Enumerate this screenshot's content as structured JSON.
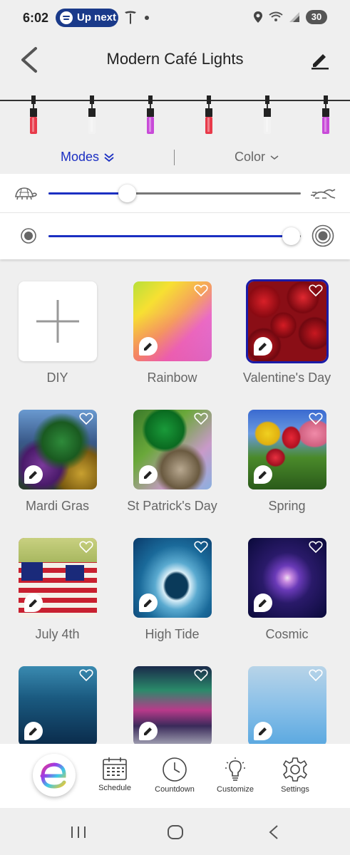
{
  "status_bar": {
    "time": "6:02",
    "media_pill": "Up next",
    "battery": "30",
    "icons": [
      "spotify-icon",
      "tesla-icon",
      "location-icon",
      "wifi-icon",
      "signal-icon"
    ]
  },
  "header": {
    "title": "Modern Café Lights",
    "back_icon": "back-chevron-icon",
    "edit_icon": "pencil-icon"
  },
  "light_string": {
    "bulb_colors": [
      "#e83a4a",
      "#f2f2f2",
      "#c84ad8",
      "#e83a4a",
      "#f2f2f2",
      "#c84ad8"
    ]
  },
  "tabs": {
    "modes_label": "Modes",
    "color_label": "Color",
    "active": "Modes"
  },
  "sliders": {
    "speed": {
      "value_percent": 31,
      "left_icon": "turtle-icon",
      "right_icon": "rabbit-icon"
    },
    "brightness": {
      "value_percent": 96,
      "left_icon": "dim-circle-icon",
      "right_icon": "bright-circle-icon"
    }
  },
  "modes": [
    {
      "label": "DIY",
      "type": "diy"
    },
    {
      "label": "Rainbow",
      "favorite": false
    },
    {
      "label": "Valentine's Day",
      "favorite": false,
      "selected": true
    },
    {
      "label": "Mardi Gras",
      "favorite": false
    },
    {
      "label": "St Patrick's Day",
      "favorite": false
    },
    {
      "label": "Spring",
      "favorite": false
    },
    {
      "label": "July 4th",
      "favorite": false
    },
    {
      "label": "High Tide",
      "favorite": false
    },
    {
      "label": "Cosmic",
      "favorite": false
    },
    {
      "label": "",
      "favorite": false
    },
    {
      "label": "",
      "favorite": false
    },
    {
      "label": "",
      "favorite": false
    }
  ],
  "bottom_nav": {
    "schedule": "Schedule",
    "countdown": "Countdown",
    "customize": "Customize",
    "settings": "Settings"
  },
  "colors": {
    "accent": "#1b2fc2",
    "selected_outline": "#1b1ba8"
  }
}
